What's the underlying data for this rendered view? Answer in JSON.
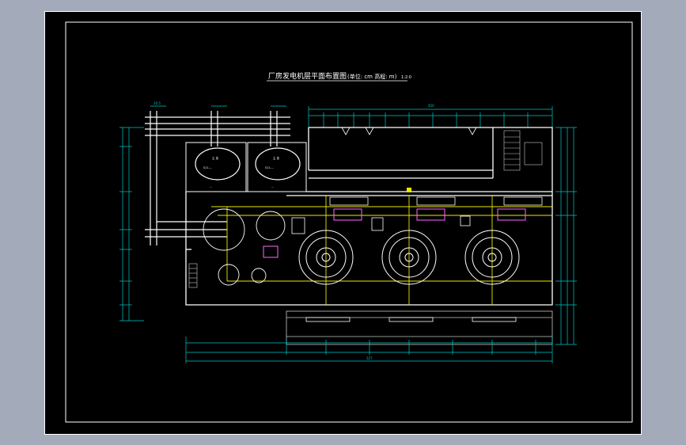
{
  "drawing": {
    "title": "厂房发电机层平面布置图",
    "title_note": "(单位: cm 高程: m)",
    "scale": "1:2:0",
    "background": "#000000",
    "frame_color": "#ffffff"
  },
  "colors": {
    "walls": "#ffffff",
    "dimensions": "#00c8c8",
    "axis_lines": "#e8e800",
    "highlight_boxes": "#ff66ff",
    "stairs": "#c8c8c8"
  },
  "labels": {
    "transformer_1_tag": "主 变",
    "transformer_1_spec": "S11-...",
    "transformer_1_base": "...",
    "transformer_2_tag": "主 变",
    "transformer_2_spec": "S11-...",
    "transformer_2_base": "...",
    "top_dim_total": "450",
    "bottom_dim_total": "327",
    "left_top_dim": "10.5",
    "center_text_1": "...",
    "center_text_2": "...",
    "unit_tag": "...",
    "gen_tag": "..."
  }
}
